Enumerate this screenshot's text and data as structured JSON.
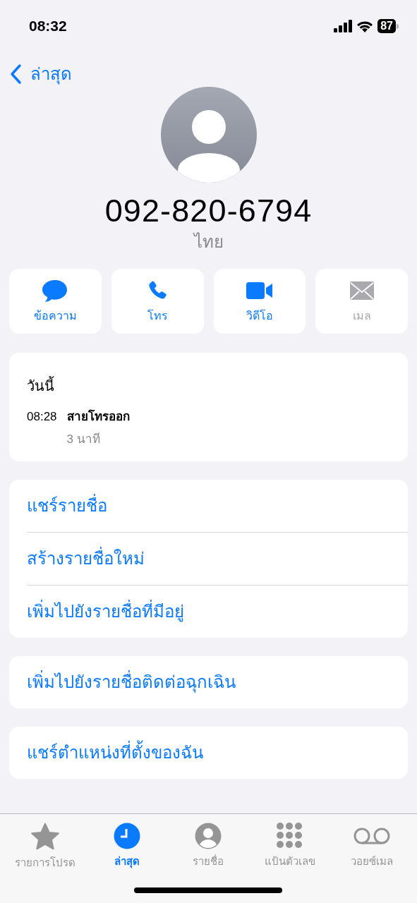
{
  "status_bar": {
    "time": "08:32",
    "battery": "87"
  },
  "nav": {
    "back_label": "ล่าสุด"
  },
  "contact": {
    "number": "092-820-6794",
    "country": "ไทย"
  },
  "actions": [
    {
      "kind": "message",
      "label": "ข้อความ",
      "disabled": false
    },
    {
      "kind": "call",
      "label": "โทร",
      "disabled": false
    },
    {
      "kind": "video",
      "label": "วิดีโอ",
      "disabled": false
    },
    {
      "kind": "mail",
      "label": "เมล",
      "disabled": true
    }
  ],
  "call_log": {
    "heading": "วันนี้",
    "entries": [
      {
        "time": "08:28",
        "type": "สายโทรออก",
        "duration": "3 นาที"
      }
    ]
  },
  "option_groups": [
    [
      "แชร์รายชื่อ",
      "สร้างรายชื่อใหม่",
      "เพิ่มไปยังรายชื่อที่มีอยู่"
    ],
    [
      "เพิ่มไปยังรายชื่อติดต่อฉุกเฉิน"
    ],
    [
      "แชร์ตำแหน่งที่ตั้งของฉัน"
    ]
  ],
  "tab_bar": [
    {
      "kind": "favorites",
      "label": "รายการโปรด",
      "selected": false
    },
    {
      "kind": "recents",
      "label": "ล่าสุด",
      "selected": true
    },
    {
      "kind": "contacts",
      "label": "รายชื่อ",
      "selected": false
    },
    {
      "kind": "keypad",
      "label": "แป้นตัวเลข",
      "selected": false
    },
    {
      "kind": "voicemail",
      "label": "วอยซ์เมล",
      "selected": false
    }
  ]
}
